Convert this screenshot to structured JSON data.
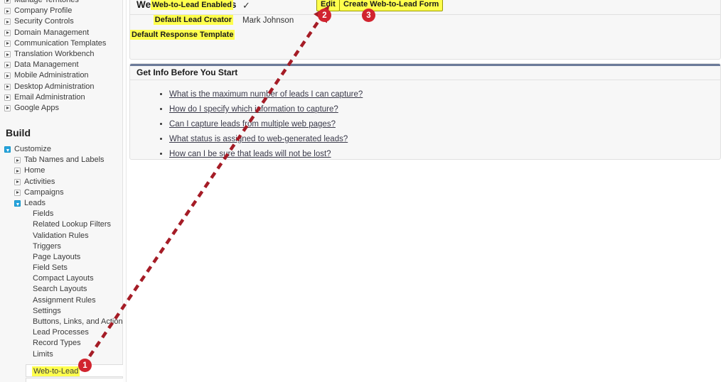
{
  "sidebar": {
    "administer_items": [
      {
        "label": "Manage Territories",
        "icon": "twisty-collapsed-icon",
        "clipped": true
      },
      {
        "label": "Company Profile",
        "icon": "twisty-collapsed-icon"
      },
      {
        "label": "Security Controls",
        "icon": "twisty-collapsed-icon"
      },
      {
        "label": "Domain Management",
        "icon": "twisty-collapsed-icon"
      },
      {
        "label": "Communication Templates",
        "icon": "twisty-collapsed-icon"
      },
      {
        "label": "Translation Workbench",
        "icon": "twisty-collapsed-icon"
      },
      {
        "label": "Data Management",
        "icon": "twisty-collapsed-icon"
      },
      {
        "label": "Mobile Administration",
        "icon": "twisty-collapsed-icon"
      },
      {
        "label": "Desktop Administration",
        "icon": "twisty-collapsed-icon"
      },
      {
        "label": "Email Administration",
        "icon": "twisty-collapsed-icon"
      },
      {
        "label": "Google Apps",
        "icon": "twisty-collapsed-icon"
      }
    ],
    "build_heading": "Build",
    "customize": {
      "label": "Customize",
      "icon": "twisty-expanded-icon"
    },
    "customize_children": [
      {
        "label": "Tab Names and Labels",
        "icon": "twisty-collapsed-icon"
      },
      {
        "label": "Home",
        "icon": "twisty-collapsed-icon"
      },
      {
        "label": "Activities",
        "icon": "twisty-collapsed-icon"
      },
      {
        "label": "Campaigns",
        "icon": "twisty-collapsed-icon"
      },
      {
        "label": "Leads",
        "icon": "twisty-expanded-icon"
      }
    ],
    "leads_children": [
      "Fields",
      "Related Lookup Filters",
      "Validation Rules",
      "Triggers",
      "Page Layouts",
      "Field Sets",
      "Compact Layouts",
      "Search Layouts",
      "Assignment Rules",
      "Settings",
      "Buttons, Links, and Actions",
      "Lead Processes",
      "Record Types",
      "Limits"
    ],
    "selected_item": "Web-to-Lead"
  },
  "settings_panel": {
    "title": "Web-to-Lead Settings",
    "edit_label": "Edit",
    "create_form_label": "Create Web-to-Lead Form",
    "fields": [
      {
        "label": "Web-to-Lead Enabled",
        "value": "✓",
        "is_check": true
      },
      {
        "label": "Default Lead Creator",
        "value": "Mark Johnson",
        "is_check": false
      },
      {
        "label": "Default Response Template",
        "value": "",
        "is_check": false
      }
    ]
  },
  "info_panel": {
    "title": "Get Info Before You Start",
    "links": [
      "What is the maximum number of leads I can capture?",
      "How do I specify which information to capture?",
      "Can I capture leads from multiple web pages?",
      "What status is assigned to web-generated leads?",
      "How can I be sure that leads will not be lost?"
    ]
  },
  "annotations": {
    "arrow_color": "#a51c26",
    "badge_color": "#d1242f",
    "highlight_color": "#ffff4d",
    "badges": [
      {
        "number": "1",
        "target": "Web-to-Lead"
      },
      {
        "number": "2",
        "target": "Edit"
      },
      {
        "number": "3",
        "target": "Create Web-to-Lead Form"
      }
    ]
  }
}
